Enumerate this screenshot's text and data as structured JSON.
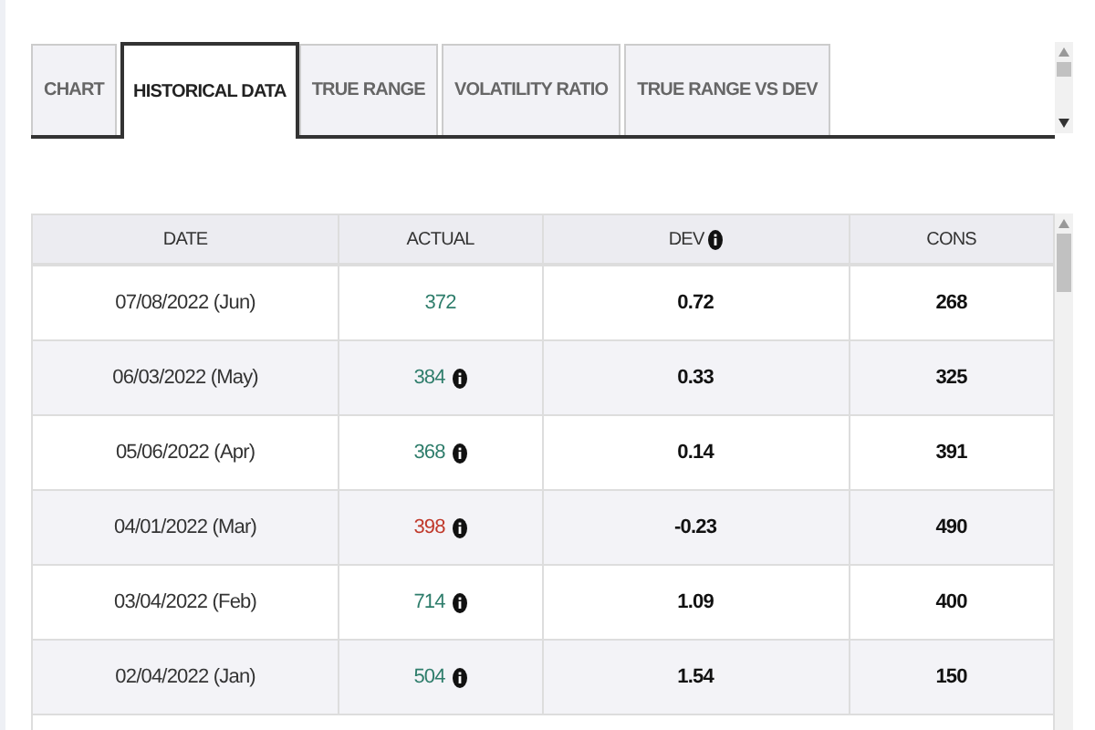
{
  "tabs": [
    {
      "label": "CHART",
      "selected": false
    },
    {
      "label": "HISTORICAL DATA",
      "selected": true
    },
    {
      "label": "TRUE RANGE",
      "selected": false
    },
    {
      "label": "VOLATILITY RATIO",
      "selected": false
    },
    {
      "label": "TRUE RANGE VS DEV",
      "selected": false
    }
  ],
  "table": {
    "columns": [
      {
        "label": "DATE",
        "info": false
      },
      {
        "label": "ACTUAL",
        "info": false
      },
      {
        "label": "DEV",
        "info": true
      },
      {
        "label": "CONS",
        "info": false
      }
    ],
    "rows": [
      {
        "date": "07/08/2022 (Jun)",
        "actual": "372",
        "color": "#2e7d6b",
        "info": false,
        "dev": "0.72",
        "cons": "268"
      },
      {
        "date": "06/03/2022 (May)",
        "actual": "384",
        "color": "#2e7d6b",
        "info": true,
        "dev": "0.33",
        "cons": "325"
      },
      {
        "date": "05/06/2022 (Apr)",
        "actual": "368",
        "color": "#2e7d6b",
        "info": true,
        "dev": "0.14",
        "cons": "391"
      },
      {
        "date": "04/01/2022 (Mar)",
        "actual": "398",
        "color": "#c0392b",
        "info": true,
        "dev": "-0.23",
        "cons": "490"
      },
      {
        "date": "03/04/2022 (Feb)",
        "actual": "714",
        "color": "#2e7d6b",
        "info": true,
        "dev": "1.09",
        "cons": "400"
      },
      {
        "date": "02/04/2022 (Jan)",
        "actual": "504",
        "color": "#2e7d6b",
        "info": true,
        "dev": "1.54",
        "cons": "150"
      }
    ]
  }
}
